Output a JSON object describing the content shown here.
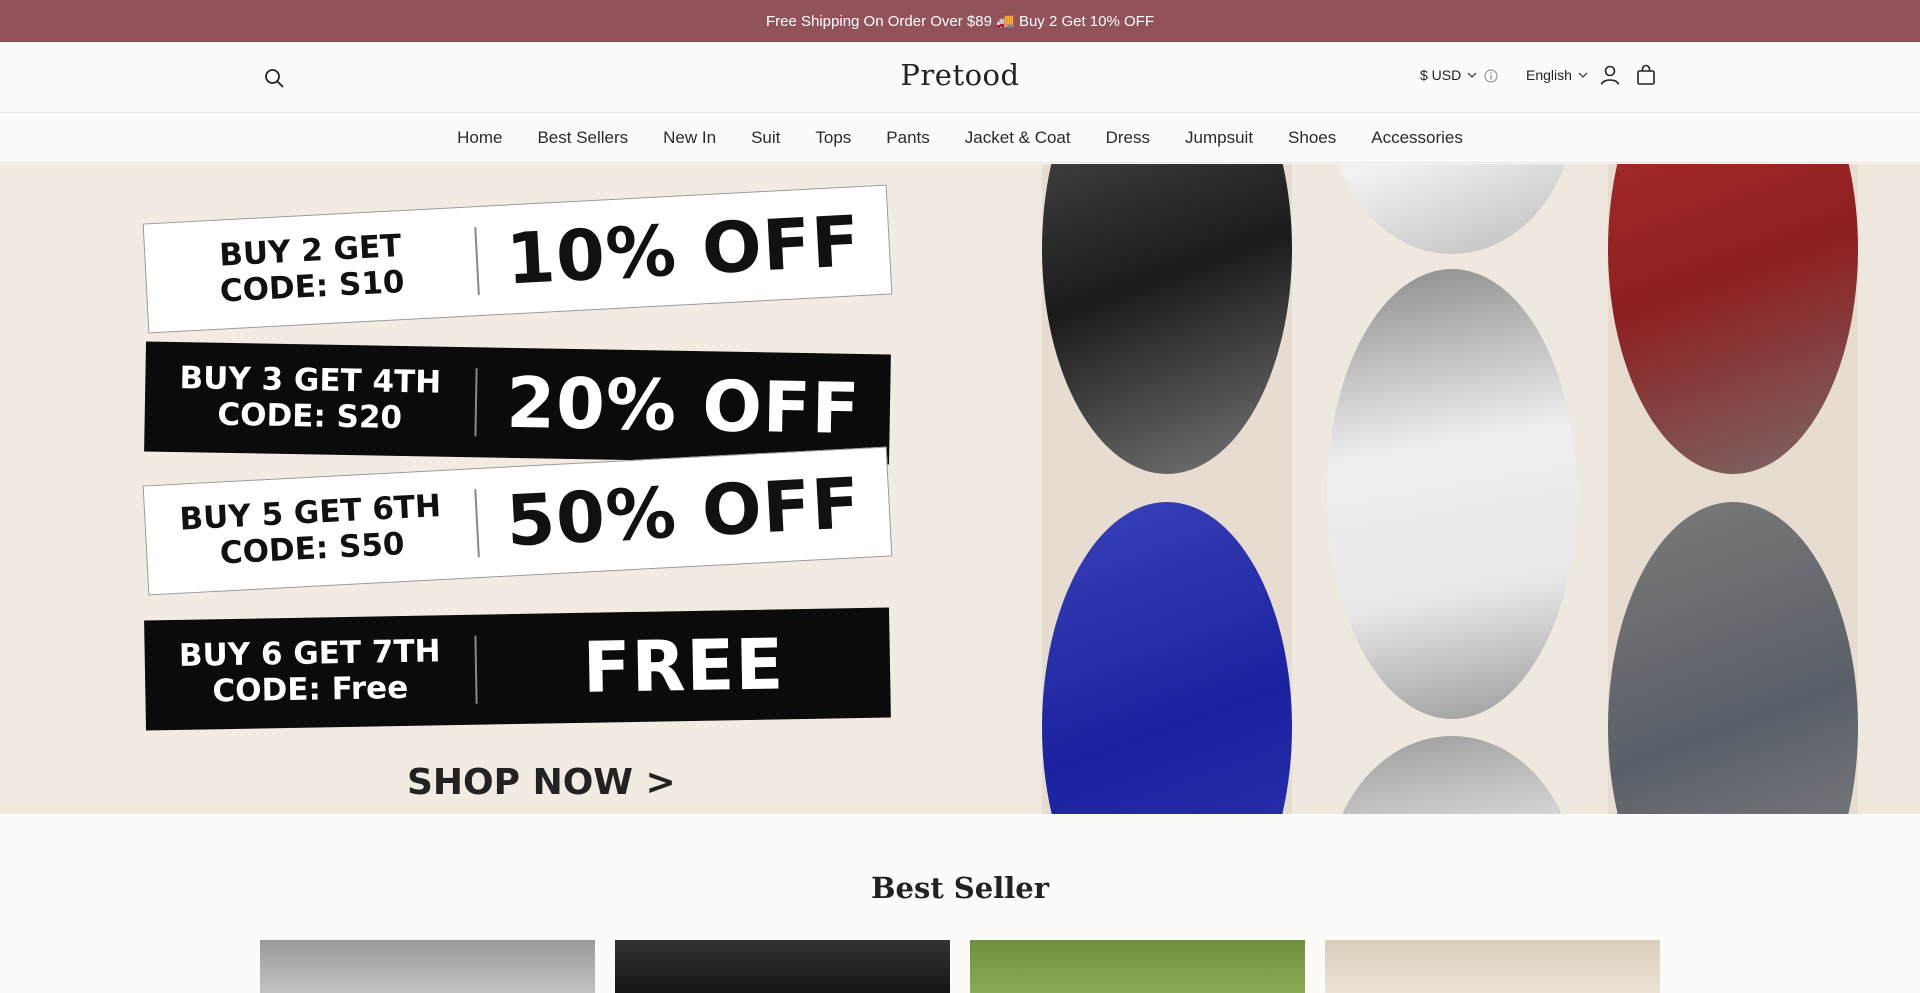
{
  "announcement": "Free Shipping On Order Over $89 🚚 Buy 2 Get 10% OFF",
  "header": {
    "logo": "Pretood",
    "currency": "$ USD",
    "language": "English"
  },
  "nav": {
    "items": [
      "Home",
      "Best Sellers",
      "New In",
      "Suit",
      "Tops",
      "Pants",
      "Jacket & Coat",
      "Dress",
      "Jumpsuit",
      "Shoes",
      "Accessories"
    ]
  },
  "hero": {
    "offers": [
      {
        "code": "BUY 2 GET\nCODE: S10",
        "discount": "10% OFF"
      },
      {
        "code": "BUY 3 GET 4TH\nCODE: S20",
        "discount": "20% OFF"
      },
      {
        "code": "BUY 5 GET 6TH\nCODE: S50",
        "discount": "50% OFF"
      },
      {
        "code": "BUY 6 GET 7TH\nCODE: Free",
        "discount": "FREE"
      }
    ],
    "cta": "SHOP NOW >"
  },
  "best_seller": {
    "title": "Best Seller"
  },
  "colors": {
    "announcement_bg": "#915259",
    "hero_bg": "#f1ebe2"
  }
}
